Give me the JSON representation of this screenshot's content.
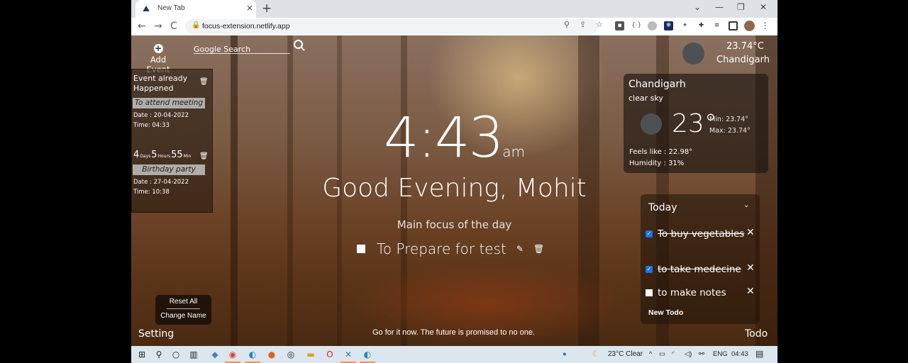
{
  "browser": {
    "tab_title": "New Tab",
    "tab_close": "×",
    "new_tab": "+",
    "window_controls": {
      "dropdown": "⌄",
      "minimize": "—",
      "restore": "❐",
      "close": "✕"
    },
    "nav": {
      "back": "←",
      "forward": "→",
      "reload": "C"
    },
    "url": "focus-extension.netlify.app",
    "omnibox_icons": [
      "location-icon",
      "share-icon",
      "star-icon"
    ],
    "extensions": [
      "ext-1",
      "ext-2",
      "ext-3",
      "ext-4",
      "ext-5",
      "puzzle-icon",
      "media-icon",
      "sidepanel-icon",
      "avatar",
      "menu-icon"
    ]
  },
  "page": {
    "add_event": {
      "icon": "+",
      "label": "Add Event"
    },
    "search": {
      "placeholder": "Google Search"
    },
    "events": [
      {
        "status": "Event already Happened",
        "title": "To attend meeting",
        "date": "Date : 20-04-2022",
        "time": "Time: 04:33"
      },
      {
        "countdown": {
          "days": "4",
          "days_label": "Days",
          "hours": "5",
          "hours_label": "Hours",
          "mins": "55",
          "mins_label": "Min"
        },
        "title": "Birthday party",
        "date": "Date : 27-04-2022",
        "time": "Time: 10:38"
      }
    ],
    "clock": {
      "time": "4:43",
      "ampm": "am"
    },
    "greeting": "Good Evening, Mohit",
    "focus": {
      "label": "Main focus of the day",
      "text": "To Prepare for test",
      "checked": false
    },
    "weather_mini": {
      "temp": "23.74°C",
      "city": "Chandigarh"
    },
    "weather_card": {
      "city": "Chandigarh",
      "description": "clear sky",
      "temp": "23°",
      "min": "Min: 23.74°",
      "max": "Max: 23.74°",
      "feels_like": "Feels like : 22.98°",
      "humidity": "Humidity : 31%"
    },
    "todo": {
      "filter": "Today",
      "items": [
        {
          "text": "To buy vegetables",
          "done": true
        },
        {
          "text": "to take medecine",
          "done": true
        },
        {
          "text": "to make notes",
          "done": false
        }
      ],
      "remove": "✕",
      "new_todo": "New Todo"
    },
    "settings_menu": {
      "reset": "Reset All",
      "change_name": "Change Name"
    },
    "setting_label": "Setting",
    "quote": "Go for it now. The future is promised to no one.",
    "todo_label": "Todo"
  },
  "taskbar": {
    "apps": [
      "start",
      "search",
      "cortana",
      "task-view",
      "app-1",
      "chrome",
      "edge",
      "firefox",
      "app-2",
      "file-explorer",
      "opera",
      "vscode",
      "edge-2"
    ],
    "weather": "23°C  Clear",
    "language": "ENG",
    "clock": "04:43"
  }
}
